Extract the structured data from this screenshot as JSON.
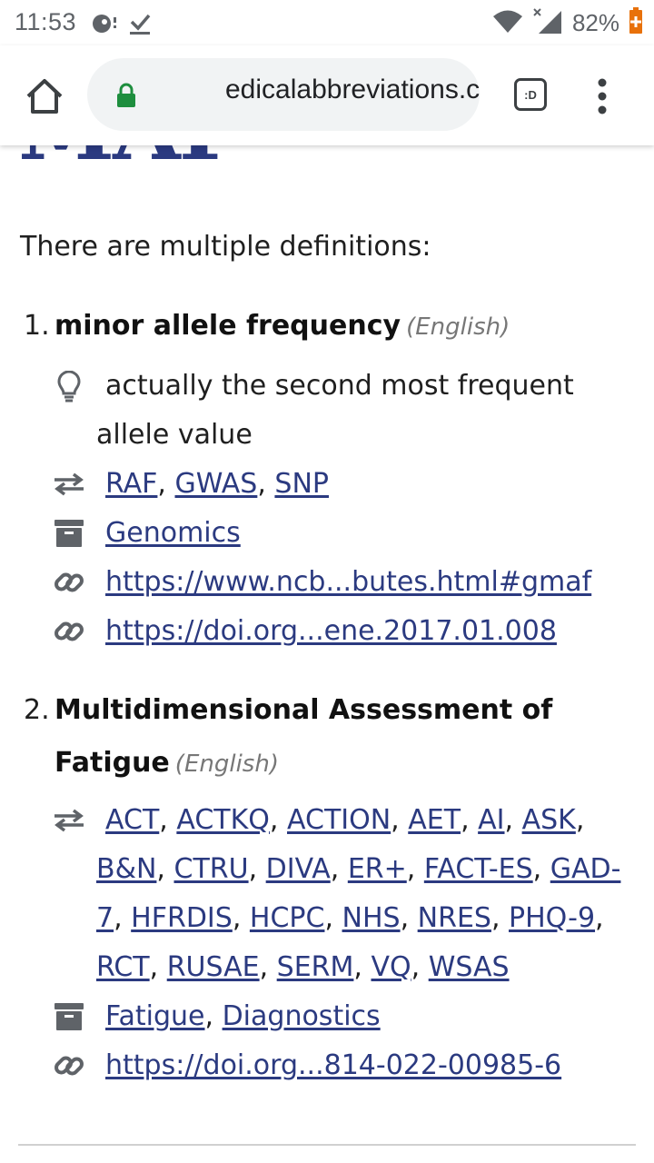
{
  "status_bar": {
    "time": "11:53",
    "battery": "82%"
  },
  "browser": {
    "url": "edicalabbreviations.com",
    "tab_label": ":D"
  },
  "page": {
    "heading": "MAF",
    "intro": "There are multiple definitions:",
    "definitions": [
      {
        "number": "1.",
        "term": "minor allele frequency",
        "language": "(English)",
        "note": [
          "actually the second most frequent",
          "allele value"
        ],
        "related": [
          "RAF",
          "GWAS",
          "SNP"
        ],
        "categories": [
          "Genomics"
        ],
        "links": [
          "https://www.ncb...butes.html#gmaf",
          "https://doi.org...ene.2017.01.008"
        ]
      },
      {
        "number": "2.",
        "term_line1": "Multidimensional Assessment of",
        "term_line2": "Fatigue",
        "language": "(English)",
        "related": [
          "ACT",
          "ACTKQ",
          "ACTION",
          "AET",
          "AI",
          "ASK",
          "B&N",
          "CTRU",
          "DIVA",
          "ER+",
          "FACT-ES",
          "GAD-7",
          "HFRDIS",
          "HCPC",
          "NHS",
          "NRES",
          "PHQ-9",
          "RCT",
          "RUSAE",
          "SERM",
          "VQ",
          "WSAS"
        ],
        "categories": [
          "Fatigue",
          "Diagnostics"
        ],
        "links": [
          "https://doi.org...814-022-00985-6"
        ]
      }
    ]
  },
  "colors": {
    "link": "#2b3a80",
    "icon": "#5f6368",
    "lock": "#1e8e3e"
  }
}
